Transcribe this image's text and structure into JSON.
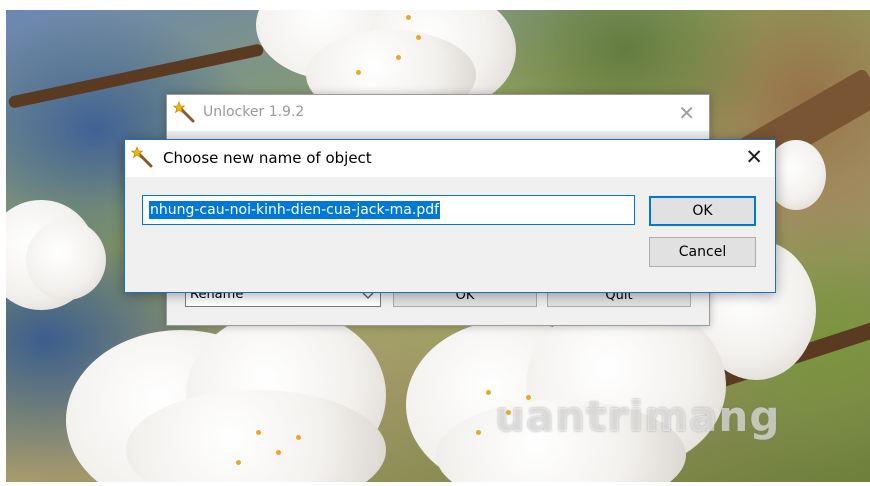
{
  "background_window": {
    "title": "Unlocker 1.9.2",
    "action_select_value": "Rename",
    "ok_label": "OK",
    "quit_label": "Quit",
    "close_glyph": "✕"
  },
  "dialog": {
    "title": "Choose new name of object",
    "close_glyph": "✕",
    "name_value": "nhung-cau-noi-kinh-dien-cua-jack-ma.pdf",
    "ok_label": "OK",
    "cancel_label": "Cancel"
  },
  "watermark": "uantrimang",
  "icons": {
    "app": "magic-wand-icon",
    "dropdown": "chevron-down-icon"
  },
  "colors": {
    "accent": "#0078d7",
    "selection_text": "#ffffff",
    "button_face": "#e1e1e1",
    "window_face": "#f0f0f0"
  }
}
